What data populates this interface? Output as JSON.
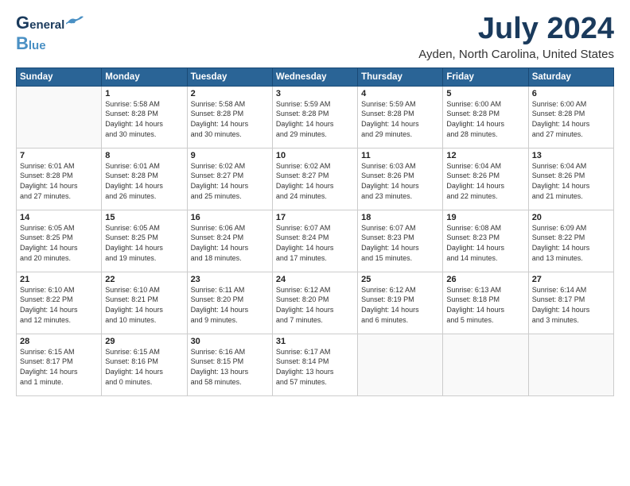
{
  "header": {
    "logo_line1": "General",
    "logo_line2": "Blue",
    "month": "July 2024",
    "location": "Ayden, North Carolina, United States"
  },
  "weekdays": [
    "Sunday",
    "Monday",
    "Tuesday",
    "Wednesday",
    "Thursday",
    "Friday",
    "Saturday"
  ],
  "weeks": [
    [
      {
        "day": "",
        "info": ""
      },
      {
        "day": "1",
        "info": "Sunrise: 5:58 AM\nSunset: 8:28 PM\nDaylight: 14 hours\nand 30 minutes."
      },
      {
        "day": "2",
        "info": "Sunrise: 5:58 AM\nSunset: 8:28 PM\nDaylight: 14 hours\nand 30 minutes."
      },
      {
        "day": "3",
        "info": "Sunrise: 5:59 AM\nSunset: 8:28 PM\nDaylight: 14 hours\nand 29 minutes."
      },
      {
        "day": "4",
        "info": "Sunrise: 5:59 AM\nSunset: 8:28 PM\nDaylight: 14 hours\nand 29 minutes."
      },
      {
        "day": "5",
        "info": "Sunrise: 6:00 AM\nSunset: 8:28 PM\nDaylight: 14 hours\nand 28 minutes."
      },
      {
        "day": "6",
        "info": "Sunrise: 6:00 AM\nSunset: 8:28 PM\nDaylight: 14 hours\nand 27 minutes."
      }
    ],
    [
      {
        "day": "7",
        "info": "Sunrise: 6:01 AM\nSunset: 8:28 PM\nDaylight: 14 hours\nand 27 minutes."
      },
      {
        "day": "8",
        "info": "Sunrise: 6:01 AM\nSunset: 8:28 PM\nDaylight: 14 hours\nand 26 minutes."
      },
      {
        "day": "9",
        "info": "Sunrise: 6:02 AM\nSunset: 8:27 PM\nDaylight: 14 hours\nand 25 minutes."
      },
      {
        "day": "10",
        "info": "Sunrise: 6:02 AM\nSunset: 8:27 PM\nDaylight: 14 hours\nand 24 minutes."
      },
      {
        "day": "11",
        "info": "Sunrise: 6:03 AM\nSunset: 8:26 PM\nDaylight: 14 hours\nand 23 minutes."
      },
      {
        "day": "12",
        "info": "Sunrise: 6:04 AM\nSunset: 8:26 PM\nDaylight: 14 hours\nand 22 minutes."
      },
      {
        "day": "13",
        "info": "Sunrise: 6:04 AM\nSunset: 8:26 PM\nDaylight: 14 hours\nand 21 minutes."
      }
    ],
    [
      {
        "day": "14",
        "info": "Sunrise: 6:05 AM\nSunset: 8:25 PM\nDaylight: 14 hours\nand 20 minutes."
      },
      {
        "day": "15",
        "info": "Sunrise: 6:05 AM\nSunset: 8:25 PM\nDaylight: 14 hours\nand 19 minutes."
      },
      {
        "day": "16",
        "info": "Sunrise: 6:06 AM\nSunset: 8:24 PM\nDaylight: 14 hours\nand 18 minutes."
      },
      {
        "day": "17",
        "info": "Sunrise: 6:07 AM\nSunset: 8:24 PM\nDaylight: 14 hours\nand 17 minutes."
      },
      {
        "day": "18",
        "info": "Sunrise: 6:07 AM\nSunset: 8:23 PM\nDaylight: 14 hours\nand 15 minutes."
      },
      {
        "day": "19",
        "info": "Sunrise: 6:08 AM\nSunset: 8:23 PM\nDaylight: 14 hours\nand 14 minutes."
      },
      {
        "day": "20",
        "info": "Sunrise: 6:09 AM\nSunset: 8:22 PM\nDaylight: 14 hours\nand 13 minutes."
      }
    ],
    [
      {
        "day": "21",
        "info": "Sunrise: 6:10 AM\nSunset: 8:22 PM\nDaylight: 14 hours\nand 12 minutes."
      },
      {
        "day": "22",
        "info": "Sunrise: 6:10 AM\nSunset: 8:21 PM\nDaylight: 14 hours\nand 10 minutes."
      },
      {
        "day": "23",
        "info": "Sunrise: 6:11 AM\nSunset: 8:20 PM\nDaylight: 14 hours\nand 9 minutes."
      },
      {
        "day": "24",
        "info": "Sunrise: 6:12 AM\nSunset: 8:20 PM\nDaylight: 14 hours\nand 7 minutes."
      },
      {
        "day": "25",
        "info": "Sunrise: 6:12 AM\nSunset: 8:19 PM\nDaylight: 14 hours\nand 6 minutes."
      },
      {
        "day": "26",
        "info": "Sunrise: 6:13 AM\nSunset: 8:18 PM\nDaylight: 14 hours\nand 5 minutes."
      },
      {
        "day": "27",
        "info": "Sunrise: 6:14 AM\nSunset: 8:17 PM\nDaylight: 14 hours\nand 3 minutes."
      }
    ],
    [
      {
        "day": "28",
        "info": "Sunrise: 6:15 AM\nSunset: 8:17 PM\nDaylight: 14 hours\nand 1 minute."
      },
      {
        "day": "29",
        "info": "Sunrise: 6:15 AM\nSunset: 8:16 PM\nDaylight: 14 hours\nand 0 minutes."
      },
      {
        "day": "30",
        "info": "Sunrise: 6:16 AM\nSunset: 8:15 PM\nDaylight: 13 hours\nand 58 minutes."
      },
      {
        "day": "31",
        "info": "Sunrise: 6:17 AM\nSunset: 8:14 PM\nDaylight: 13 hours\nand 57 minutes."
      },
      {
        "day": "",
        "info": ""
      },
      {
        "day": "",
        "info": ""
      },
      {
        "day": "",
        "info": ""
      }
    ]
  ]
}
